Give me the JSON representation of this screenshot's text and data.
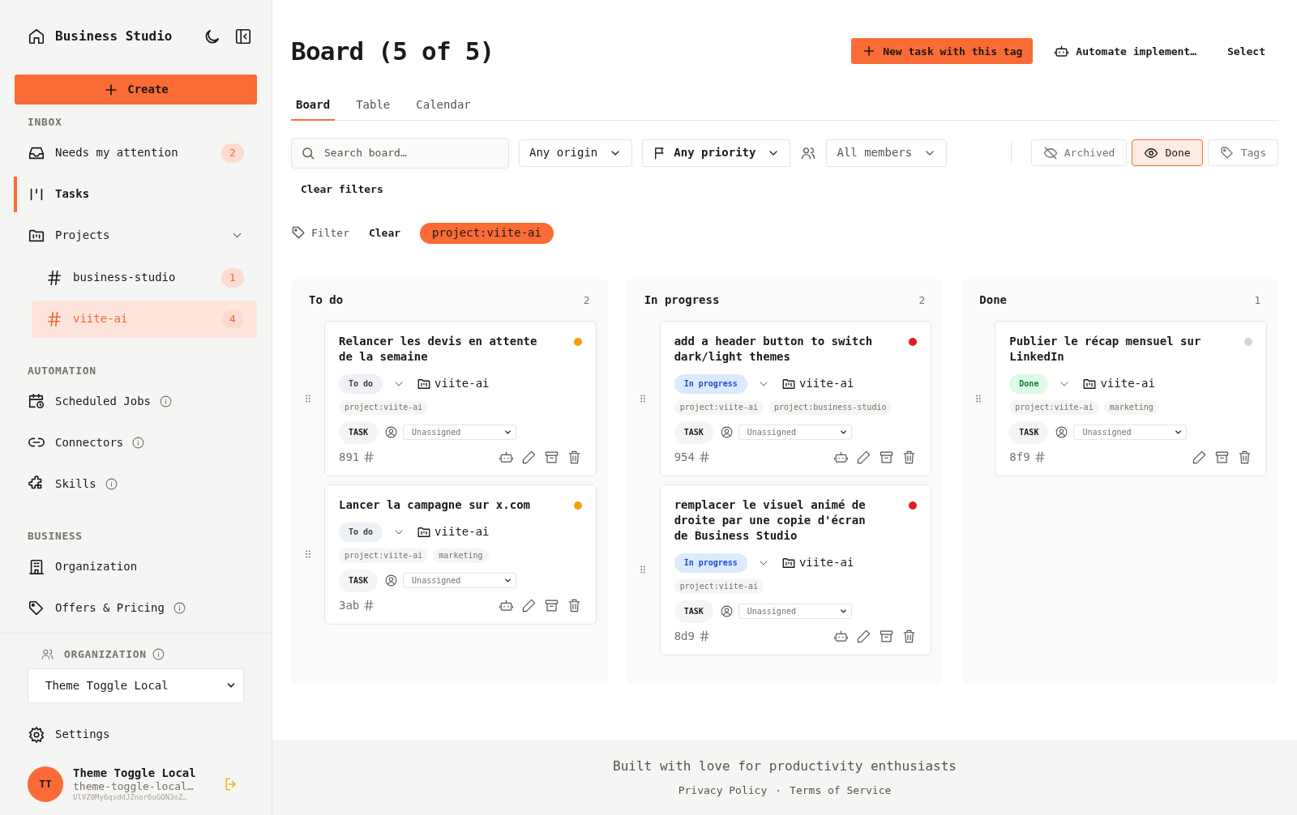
{
  "sidebar": {
    "brand": "Business Studio",
    "create_button": "Create",
    "sections": [
      {
        "heading": "INBOX",
        "items": [
          {
            "label": "Needs my attention",
            "badge": "2",
            "selected": false,
            "info": false
          },
          {
            "label": "Tasks",
            "selected": true,
            "info": false
          },
          {
            "label": "Projects",
            "selected": false,
            "info": false,
            "expanded": true,
            "children": [
              {
                "label": "business-studio",
                "badge": "1",
                "selected": false
              },
              {
                "label": "viite-ai",
                "badge": "4",
                "selected": true
              }
            ]
          }
        ]
      },
      {
        "heading": "AUTOMATION",
        "items": [
          {
            "label": "Scheduled Jobs",
            "selected": false,
            "info": true
          },
          {
            "label": "Connectors",
            "selected": false,
            "info": true
          },
          {
            "label": "Skills",
            "selected": false,
            "info": true
          }
        ]
      },
      {
        "heading": "BUSINESS",
        "items": [
          {
            "label": "Organization",
            "selected": false,
            "info": false
          },
          {
            "label": "Offers & Pricing",
            "selected": false,
            "info": true
          }
        ]
      }
    ],
    "organization": {
      "heading": "ORGANIZATION",
      "value": "Theme Toggle Local"
    },
    "settings": "Settings",
    "user": {
      "initials": "TT",
      "name": "Theme Toggle Local",
      "email": "theme-toggle-local…",
      "id": "UlVZ0My6qsddJZnor6uGQN3oZ…"
    }
  },
  "main": {
    "title": "Board (5 of 5)",
    "header_actions": [
      {
        "kind": "primary",
        "label": "New task with this tag"
      },
      {
        "kind": "robot",
        "label": "Automate implement…"
      },
      {
        "kind": "plain",
        "label": "Select"
      }
    ],
    "tabs": [
      {
        "label": "Board",
        "selected": true
      },
      {
        "label": "Table",
        "selected": false
      },
      {
        "label": "Calendar",
        "selected": false
      }
    ],
    "filters": {
      "search_placeholder": "Search board…",
      "origin": "Any origin",
      "priority": "Any priority",
      "members": "All members",
      "toggles": [
        {
          "kind": "visibility",
          "label": "Archived",
          "on": false
        },
        {
          "kind": "visibility",
          "label": "Done",
          "on": true
        },
        {
          "kind": "tags",
          "label": "Tags",
          "on": false
        }
      ],
      "clear_filters": "Clear filters"
    },
    "tag_filter": {
      "label": "Filter",
      "clear": "Clear",
      "tags": [
        "project:viite-ai"
      ]
    },
    "columns": [
      {
        "title": "To do",
        "count": "2",
        "cards": [
          {
            "title": "Relancer les devis en attente de la semaine",
            "color": "#f59e0b",
            "status": "To do",
            "kind": "todo",
            "project": "viite-ai",
            "tags": [
              "project:viite-ai"
            ],
            "type": "TASK",
            "assignee": "Unassigned",
            "id": "891",
            "automate": true
          },
          {
            "title": "Lancer la campagne sur x.com",
            "color": "#f59e0b",
            "status": "To do",
            "kind": "todo",
            "project": "viite-ai",
            "tags": [
              "project:viite-ai",
              "marketing"
            ],
            "type": "TASK",
            "assignee": "Unassigned",
            "id": "3ab",
            "automate": true
          }
        ]
      },
      {
        "title": "In progress",
        "count": "2",
        "cards": [
          {
            "title": "add a header button to switch dark/light themes",
            "color": "#e11d1d",
            "status": "In progress",
            "kind": "in_progress",
            "project": "viite-ai",
            "tags": [
              "project:viite-ai",
              "project:business-studio"
            ],
            "type": "TASK",
            "assignee": "Unassigned",
            "id": "954",
            "automate": true
          },
          {
            "title": "remplacer le visuel animé de droite par une copie d'écran de Business Studio",
            "color": "#e11d1d",
            "status": "In progress",
            "kind": "in_progress",
            "project": "viite-ai",
            "tags": [
              "project:viite-ai"
            ],
            "type": "TASK",
            "assignee": "Unassigned",
            "id": "8d9",
            "automate": true
          }
        ]
      },
      {
        "title": "Done",
        "count": "1",
        "cards": [
          {
            "title": "Publier le récap mensuel sur LinkedIn",
            "color": "#d4d4d4",
            "status": "Done",
            "kind": "done",
            "project": "viite-ai",
            "tags": [
              "project:viite-ai",
              "marketing"
            ],
            "type": "TASK",
            "assignee": "Unassigned",
            "id": "8f9",
            "automate": false
          }
        ]
      }
    ]
  },
  "footer": {
    "text": "Built with love for productivity enthusiasts",
    "links": [
      "Privacy Policy",
      "Terms of Service"
    ],
    "separator": "·"
  }
}
